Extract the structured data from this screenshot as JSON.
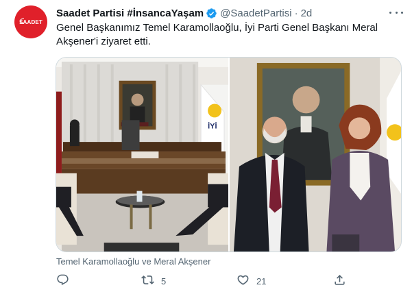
{
  "account": {
    "avatar_text": "SAADET",
    "display_name": "Saadet Partisi #İnsancaYaşam",
    "handle": "@SaadetPartisi",
    "separator": "·",
    "time": "2d"
  },
  "tweet": {
    "text": "Genel Başkanımız Temel Karamollaoğlu, İyi Parti Genel Başkanı Meral Akşener'i ziyaret etti.",
    "caption": "Temel Karamollaoğlu ve Meral Akşener"
  },
  "photo_signage": {
    "left_flag_text": "İYİ"
  },
  "actions": {
    "reply_count": "",
    "retweet_count": "5",
    "like_count": "21",
    "share_count": ""
  },
  "colors": {
    "accent": "#1d9bf0",
    "brand_red": "#e0202a",
    "secondary_text": "#536471",
    "border": "#cfd9de"
  },
  "icons": {
    "avatar": "saadet-logo",
    "verified": "verified-badge-icon",
    "more": "more-icon",
    "reply": "reply-icon",
    "retweet": "retweet-icon",
    "like": "like-icon",
    "share": "share-icon"
  }
}
